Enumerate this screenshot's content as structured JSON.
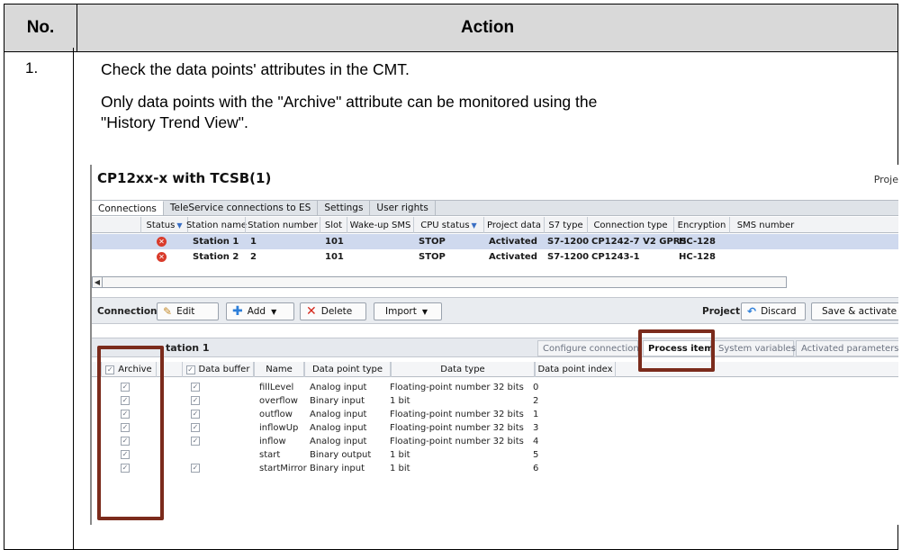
{
  "doc_table": {
    "header_no": "No.",
    "header_action": "Action",
    "row_no": "1.",
    "line1": "Check the data points' attributes in the CMT.",
    "line2": "Only data points with the \"Archive\" attribute can be monitored using the",
    "line3": "\"History Trend View\"."
  },
  "cmt": {
    "title": "CP12xx-x with TCSB(1)",
    "project_cut": "Proje",
    "tabs": [
      "Connections",
      "TeleService connections to ES",
      "Settings",
      "User rights"
    ],
    "active_tab": "Connections",
    "grid_headers": [
      "Status",
      "Station name",
      "Station number",
      "Slot",
      "Wake-up SMS",
      "CPU status",
      "Project data",
      "S7 type",
      "Connection type",
      "Encryption",
      "SMS number"
    ],
    "rows": [
      {
        "status_icon": "error-icon",
        "station_name": "Station 1",
        "station_number": "1",
        "slot": "101",
        "wake_up_sms": "",
        "cpu_status": "STOP",
        "project_data": "Activated",
        "s7_type": "S7-1200",
        "connection_type": "CP1242-7 V2 GPRS",
        "encryption": "HC-128",
        "sms_number": ""
      },
      {
        "status_icon": "error-icon",
        "station_name": "Station 2",
        "station_number": "2",
        "slot": "101",
        "wake_up_sms": "",
        "cpu_status": "STOP",
        "project_data": "Activated",
        "s7_type": "S7-1200",
        "connection_type": "CP1243-1",
        "encryption": "HC-128",
        "sms_number": ""
      }
    ],
    "toolbar": {
      "connection_label": "Connection",
      "edit": "Edit",
      "add": "Add",
      "delete": "Delete",
      "import": "Import",
      "project_label": "Project",
      "discard": "Discard",
      "save_activate": "Save & activate"
    },
    "section_title": "tation 1",
    "sub_tabs": [
      "Configure connection",
      "Process items",
      "System variables",
      "Activated parameters"
    ],
    "active_sub_tab": "Process items",
    "pi_headers": [
      "Archive",
      "Data buffer",
      "Name",
      "Data point type",
      "Data type",
      "Data point index"
    ],
    "process_items": [
      {
        "archive": true,
        "data_buffer": true,
        "name": "fillLevel",
        "dp_type": "Analog input",
        "data_type": "Floating-point number 32 bits",
        "index": "0"
      },
      {
        "archive": true,
        "data_buffer": true,
        "name": "overflow",
        "dp_type": "Binary input",
        "data_type": "1 bit",
        "index": "2"
      },
      {
        "archive": true,
        "data_buffer": true,
        "name": "outflow",
        "dp_type": "Analog input",
        "data_type": "Floating-point number 32 bits",
        "index": "1"
      },
      {
        "archive": true,
        "data_buffer": true,
        "name": "inflowUp",
        "dp_type": "Analog input",
        "data_type": "Floating-point number 32 bits",
        "index": "3"
      },
      {
        "archive": true,
        "data_buffer": true,
        "name": "inflow",
        "dp_type": "Analog input",
        "data_type": "Floating-point number 32 bits",
        "index": "4"
      },
      {
        "archive": true,
        "data_buffer": false,
        "name": "start",
        "dp_type": "Binary output",
        "data_type": "1 bit",
        "index": "5"
      },
      {
        "archive": true,
        "data_buffer": true,
        "name": "startMirror",
        "dp_type": "Binary input",
        "data_type": "1 bit",
        "index": "6"
      }
    ],
    "colors": {
      "highlight": "#7b2b1c",
      "selected_row": "#cfd9ee",
      "status_error": "#d93b2b"
    }
  }
}
